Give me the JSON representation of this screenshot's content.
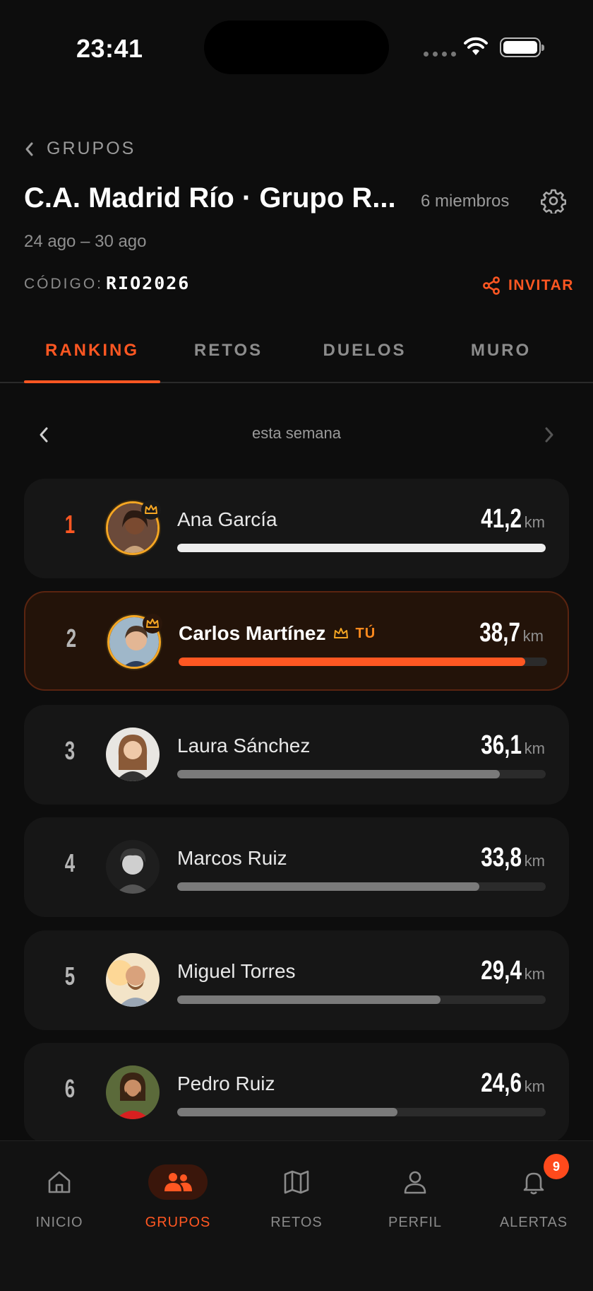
{
  "status_bar": {
    "time": "23:41"
  },
  "header": {
    "back_label": "GRUPOS",
    "title": "C.A. Madrid Río · Grupo R...",
    "members": "6 miembros",
    "dates": "24 ago – 30 ago",
    "code_label": "CÓDIGO:",
    "code_value": "RIO2026",
    "invite_label": "INVITAR"
  },
  "tabs": [
    {
      "label": "RANKING",
      "active": true
    },
    {
      "label": "RETOS",
      "active": false
    },
    {
      "label": "DUELOS",
      "active": false
    },
    {
      "label": "MURO",
      "active": false
    }
  ],
  "week_nav": {
    "label": "esta semana"
  },
  "ranking": [
    {
      "rank": "1",
      "name": "Ana García",
      "km": "41,2",
      "unit": "km",
      "progress": 1.0,
      "crown": true,
      "me": false
    },
    {
      "rank": "2",
      "name": "Carlos Martínez",
      "km": "38,7",
      "unit": "km",
      "progress": 0.94,
      "crown": true,
      "me": true,
      "me_label": "TÚ"
    },
    {
      "rank": "3",
      "name": "Laura Sánchez",
      "km": "36,1",
      "unit": "km",
      "progress": 0.876,
      "crown": false,
      "me": false
    },
    {
      "rank": "4",
      "name": "Marcos Ruiz",
      "km": "33,8",
      "unit": "km",
      "progress": 0.82,
      "crown": false,
      "me": false
    },
    {
      "rank": "5",
      "name": "Miguel Torres",
      "km": "29,4",
      "unit": "km",
      "progress": 0.714,
      "crown": false,
      "me": false
    },
    {
      "rank": "6",
      "name": "Pedro Ruiz",
      "km": "24,6",
      "unit": "km",
      "progress": 0.597,
      "crown": false,
      "me": false
    }
  ],
  "bottom_nav": [
    {
      "label": "INICIO",
      "icon": "home-icon",
      "active": false
    },
    {
      "label": "GRUPOS",
      "icon": "users-icon",
      "active": true
    },
    {
      "label": "RETOS",
      "icon": "map-icon",
      "active": false
    },
    {
      "label": "PERFIL",
      "icon": "person-icon",
      "active": false
    },
    {
      "label": "ALERTAS",
      "icon": "bell-icon",
      "active": false,
      "badge": "9"
    }
  ],
  "colors": {
    "accent": "#ff5722",
    "gold": "#f5a623",
    "background": "#0d0d0d",
    "card": "#161616"
  }
}
